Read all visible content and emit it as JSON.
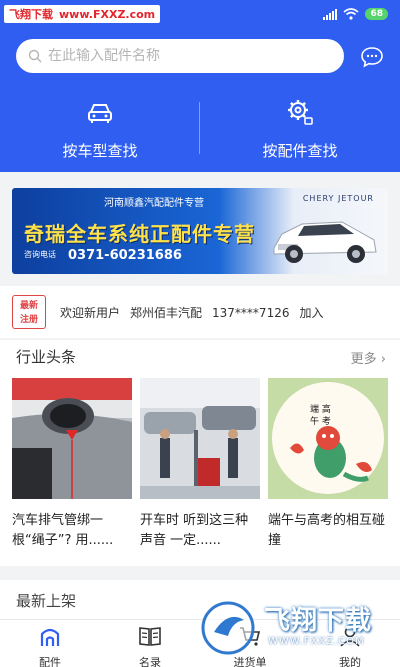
{
  "watermark": {
    "brand": "飞翔下载",
    "url": "www.FXXZ.com"
  },
  "status": {
    "battery": "68"
  },
  "search": {
    "placeholder": "在此输入配件名称"
  },
  "categories": [
    {
      "label": "按车型查找",
      "icon": "car-icon"
    },
    {
      "label": "按配件查找",
      "icon": "gear-icon"
    }
  ],
  "banner": {
    "header": "河南顺鑫汽配配件专营",
    "logos": "CHERY   JETOUR",
    "headline": "奇瑞全车系纯正配件专营",
    "phone_label": "咨询电话",
    "phone": "0371-60231686"
  },
  "ticker": {
    "badge_line1": "最新",
    "badge_line2": "注册",
    "welcome": "欢迎新用户",
    "company": "郑州佰丰汽配",
    "phone": "137****7126",
    "action": "加入"
  },
  "news": {
    "title": "行业头条",
    "more": "更多",
    "items": [
      {
        "caption": "汽车排气管绑一根“绳子”? 用......"
      },
      {
        "caption": "开车时 听到这三种声音 一定......"
      },
      {
        "caption": "端午与高考的相互碰撞"
      }
    ]
  },
  "latest": {
    "title": "最新上架"
  },
  "tabs": [
    {
      "label": "配件",
      "icon": "home-icon",
      "active": true
    },
    {
      "label": "名录",
      "icon": "book-icon",
      "active": false
    },
    {
      "label": "进货单",
      "icon": "cart-icon",
      "active": false
    },
    {
      "label": "我的",
      "icon": "user-icon",
      "active": false
    }
  ],
  "overlay": {
    "text": "飞翔下载",
    "url": "WWW.FXXZ.COM"
  },
  "colors": {
    "primary": "#2f5ef0",
    "badge_red": "#e04444",
    "battery_green": "#56d36b"
  }
}
